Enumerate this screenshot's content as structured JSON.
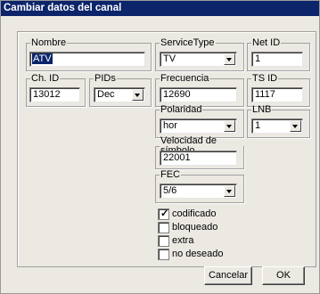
{
  "window": {
    "title": "Cambiar datos del canal"
  },
  "nombre": {
    "label": "Nombre",
    "value": "ATV"
  },
  "service_type": {
    "label": "ServiceType",
    "value": "TV"
  },
  "net_id": {
    "label": "Net ID",
    "value": "1"
  },
  "ch_id": {
    "label": "Ch. ID",
    "value": "13012"
  },
  "pids": {
    "label": "PIDs",
    "value": "Dec"
  },
  "frecuencia": {
    "label": "Frecuencia",
    "value": "12690"
  },
  "ts_id": {
    "label": "TS ID",
    "value": "1117"
  },
  "polaridad": {
    "label": "Polaridad",
    "value": "hor"
  },
  "lnb": {
    "label": "LNB",
    "value": "1"
  },
  "velocidad": {
    "label": "Velocidad de símbolo",
    "value": "22001"
  },
  "fec": {
    "label": "FEC",
    "value": "5/6"
  },
  "checks": [
    {
      "label": "codificado",
      "checked": true
    },
    {
      "label": "bloqueado",
      "checked": false
    },
    {
      "label": "extra",
      "checked": false
    },
    {
      "label": "no deseado",
      "checked": false
    }
  ],
  "buttons": {
    "cancel": "Cancelar",
    "ok": "OK"
  }
}
